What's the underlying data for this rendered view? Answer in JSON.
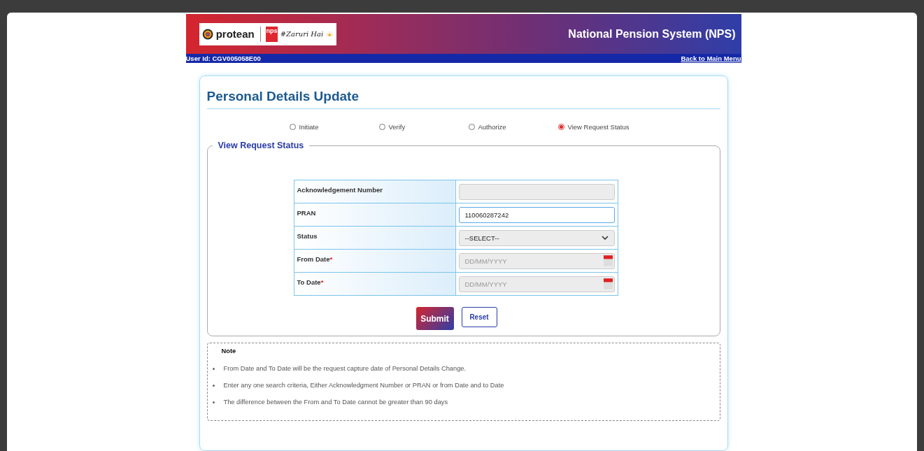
{
  "header": {
    "brand": "protean",
    "nps_mark": "nps",
    "tagline": "#Zaruri Hai",
    "title": "National Pension System (NPS)"
  },
  "user_bar": {
    "user_id": "User Id: CGV005058E00",
    "back_link": "Back to Main Menu"
  },
  "page_title": "Personal Details Update",
  "modes": [
    {
      "label": "Initiate",
      "selected": false
    },
    {
      "label": "Verify",
      "selected": false
    },
    {
      "label": "Authorize",
      "selected": false
    },
    {
      "label": "View Request Status",
      "selected": true
    }
  ],
  "section_title": "View Request Status",
  "form": [
    {
      "label": "Acknowledgement Number",
      "kind": "text",
      "disabled": true
    },
    {
      "label": "PRAN",
      "kind": "text",
      "disabled": false,
      "value": "110060287242"
    },
    {
      "label": "Status",
      "kind": "select",
      "disabled": true,
      "value": "--SELECT--"
    },
    {
      "label": "From Date",
      "kind": "date",
      "required_mark": "*",
      "disabled": true,
      "placeholder": "DD/MM/YYYY"
    },
    {
      "label": "To Date",
      "kind": "date",
      "required_mark": "*",
      "disabled": true,
      "placeholder": "DD/MM/YYYY"
    }
  ],
  "buttons": {
    "submit": "Submit",
    "reset": "Reset"
  },
  "note": {
    "title": "Note",
    "items": [
      "From Date and To Date will be the request capture date of Personal Details Change.",
      "Enter any one search criteria, Either Acknowledgment Number or PRAN or from Date and to Date",
      "The difference between the From and To Date cannot be greater than 90 days"
    ]
  }
}
